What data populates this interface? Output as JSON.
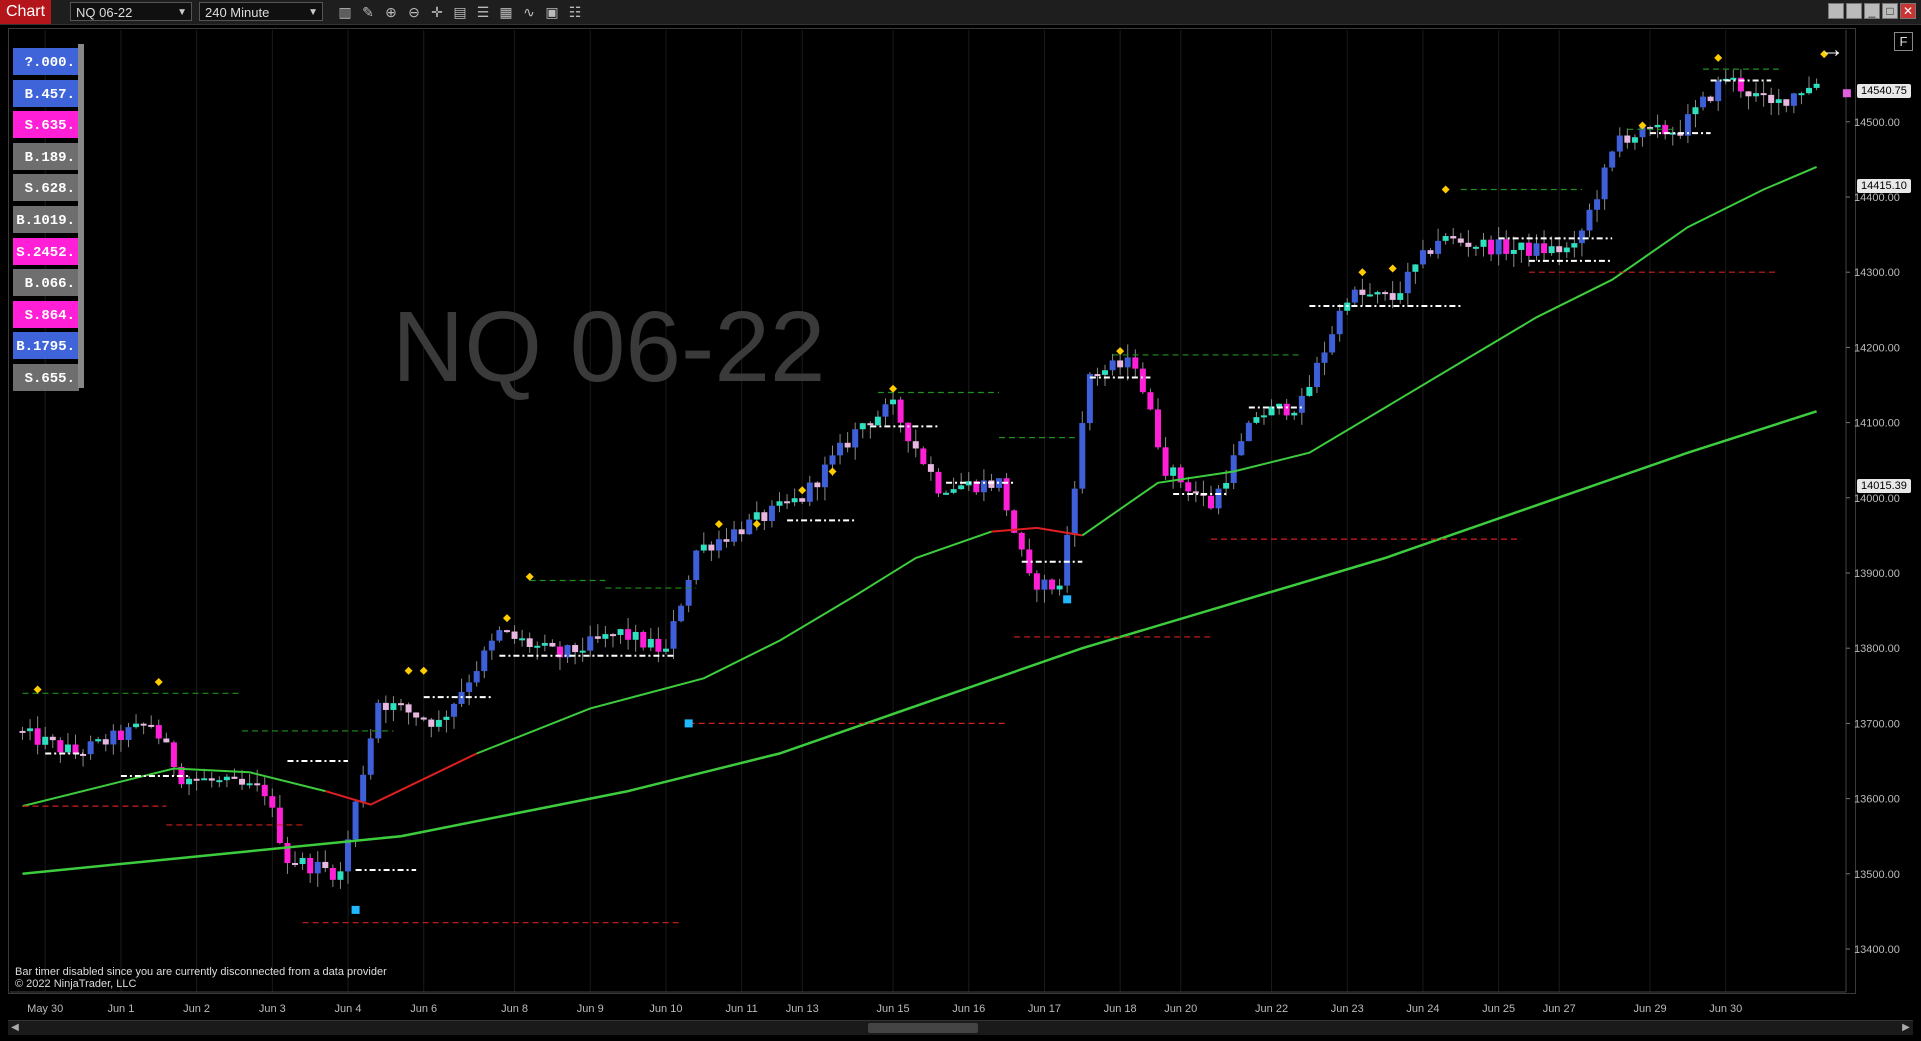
{
  "app": {
    "tab_label": "Chart"
  },
  "toolbar": {
    "instrument": "NQ 06-22",
    "interval": "240 Minute",
    "tools": [
      "bar-type-icon",
      "draw-icon",
      "zoom-in-icon",
      "zoom-out-icon",
      "crosshair-icon",
      "data-box-icon",
      "properties-icon",
      "strategy-icon",
      "indicators-icon",
      "templates-icon",
      "list-icon"
    ]
  },
  "watermark": "NQ 06-22",
  "status": {
    "line1": "Bar timer disabled since you are currently disconnected from a data provider",
    "line2": "© 2022 NinjaTrader, LLC"
  },
  "f_button": "F",
  "positions": [
    {
      "label": "?.000.",
      "color": "#3f63d9"
    },
    {
      "label": "B.457.",
      "color": "#3f63d9"
    },
    {
      "label": "S.635.",
      "color": "#ff1fd6"
    },
    {
      "label": "B.189.",
      "color": "#6e6e6e"
    },
    {
      "label": "S.628.",
      "color": "#6e6e6e"
    },
    {
      "label": "B.1019.",
      "color": "#6e6e6e"
    },
    {
      "label": "S.2452.",
      "color": "#ff1fd6"
    },
    {
      "label": "B.066.",
      "color": "#6e6e6e"
    },
    {
      "label": "S.864.",
      "color": "#ff1fd6"
    },
    {
      "label": "B.1795.",
      "color": "#3f63d9"
    },
    {
      "label": "S.655.",
      "color": "#6e6e6e"
    }
  ],
  "price_tags": [
    {
      "text": "14540.75",
      "price": 14540.75
    },
    {
      "text": "14415.10",
      "price": 14415.1
    },
    {
      "text": "14015.39",
      "price": 14015.39
    }
  ],
  "colors": {
    "bull_strong": "#3f5fd8",
    "bull_weak": "#2ee0c0",
    "bear_strong": "#ff1fd6",
    "bear_weak": "#e8b8e0",
    "ma_fast": "#3dcc3d",
    "ma_fast_down": "#e02020",
    "ma_slow": "#3dcc3d",
    "resistance": "#1f8f1f",
    "support": "#d02020",
    "pivot": "#ffffff",
    "diamond": "#ffcc00"
  },
  "chart_data": {
    "type": "candlestick",
    "instrument": "NQ 06-22",
    "interval": "240 Minute",
    "ylim": [
      13340,
      14640
    ],
    "y_ticks": [
      13400,
      13500,
      13600,
      13700,
      13800,
      13900,
      14000,
      14100,
      14200,
      14300,
      14400,
      14500
    ],
    "y_tick_labels": [
      "13400.00",
      "13500.00",
      "13600.00",
      "13700.00",
      "13800.00",
      "13900.00",
      "14000.00",
      "14100.00",
      "14200.00",
      "14300.00",
      "14400.00",
      "14500.00"
    ],
    "x_ticks": [
      {
        "label": "May 30",
        "bar": 3
      },
      {
        "label": "Jun 1",
        "bar": 13
      },
      {
        "label": "Jun 2",
        "bar": 23
      },
      {
        "label": "Jun 3",
        "bar": 33
      },
      {
        "label": "Jun 4",
        "bar": 43
      },
      {
        "label": "Jun 6",
        "bar": 53
      },
      {
        "label": "Jun 8",
        "bar": 65
      },
      {
        "label": "Jun 9",
        "bar": 75
      },
      {
        "label": "Jun 10",
        "bar": 85
      },
      {
        "label": "Jun 11",
        "bar": 95
      },
      {
        "label": "Jun 13",
        "bar": 103
      },
      {
        "label": "Jun 15",
        "bar": 115
      },
      {
        "label": "Jun 16",
        "bar": 125
      },
      {
        "label": "Jun 17",
        "bar": 135
      },
      {
        "label": "Jun 18",
        "bar": 145
      },
      {
        "label": "Jun 20",
        "bar": 153
      },
      {
        "label": "Jun 22",
        "bar": 165
      },
      {
        "label": "Jun 23",
        "bar": 175
      },
      {
        "label": "Jun 24",
        "bar": 185
      },
      {
        "label": "Jun 25",
        "bar": 195
      },
      {
        "label": "Jun 27",
        "bar": 203
      },
      {
        "label": "Jun 29",
        "bar": 215
      },
      {
        "label": "Jun 30",
        "bar": 225
      }
    ],
    "price_lines": [
      {
        "style": "resistance",
        "price": 13740,
        "from": 0,
        "to": 29
      },
      {
        "style": "resistance",
        "price": 13690,
        "from": 29,
        "to": 49
      },
      {
        "style": "resistance",
        "price": 13890,
        "from": 67,
        "to": 77
      },
      {
        "style": "resistance",
        "price": 13880,
        "from": 77,
        "to": 89
      },
      {
        "style": "resistance",
        "price": 14140,
        "from": 113,
        "to": 129
      },
      {
        "style": "resistance",
        "price": 14080,
        "from": 129,
        "to": 139
      },
      {
        "style": "resistance",
        "price": 14190,
        "from": 144,
        "to": 169
      },
      {
        "style": "resistance",
        "price": 14410,
        "from": 190,
        "to": 206
      },
      {
        "style": "resistance",
        "price": 14490,
        "from": 212,
        "to": 218
      },
      {
        "style": "resistance",
        "price": 14570,
        "from": 222,
        "to": 232
      },
      {
        "style": "support",
        "price": 13590,
        "from": 0,
        "to": 19
      },
      {
        "style": "support",
        "price": 13565,
        "from": 19,
        "to": 37
      },
      {
        "style": "support",
        "price": 13435,
        "from": 37,
        "to": 87
      },
      {
        "style": "support",
        "price": 13700,
        "from": 88,
        "to": 130
      },
      {
        "style": "support",
        "price": 13815,
        "from": 131,
        "to": 157
      },
      {
        "style": "support",
        "price": 13945,
        "from": 157,
        "to": 198
      },
      {
        "style": "support",
        "price": 14300,
        "from": 199,
        "to": 232
      },
      {
        "style": "pivot",
        "price": 13660,
        "from": 3,
        "to": 8
      },
      {
        "style": "pivot",
        "price": 13630,
        "from": 13,
        "to": 22
      },
      {
        "style": "pivot",
        "price": 13650,
        "from": 35,
        "to": 43
      },
      {
        "style": "pivot",
        "price": 13505,
        "from": 44,
        "to": 52
      },
      {
        "style": "pivot",
        "price": 13735,
        "from": 53,
        "to": 62
      },
      {
        "style": "pivot",
        "price": 13790,
        "from": 63,
        "to": 86
      },
      {
        "style": "pivot",
        "price": 13970,
        "from": 101,
        "to": 110
      },
      {
        "style": "pivot",
        "price": 14095,
        "from": 112,
        "to": 121
      },
      {
        "style": "pivot",
        "price": 14020,
        "from": 122,
        "to": 131
      },
      {
        "style": "pivot",
        "price": 13915,
        "from": 132,
        "to": 140
      },
      {
        "style": "pivot",
        "price": 14160,
        "from": 141,
        "to": 149
      },
      {
        "style": "pivot",
        "price": 14005,
        "from": 152,
        "to": 159
      },
      {
        "style": "pivot",
        "price": 14120,
        "from": 162,
        "to": 169
      },
      {
        "style": "pivot",
        "price": 14255,
        "from": 170,
        "to": 190
      },
      {
        "style": "pivot",
        "price": 14345,
        "from": 195,
        "to": 210
      },
      {
        "style": "pivot",
        "price": 14315,
        "from": 199,
        "to": 210
      },
      {
        "style": "pivot",
        "price": 14485,
        "from": 215,
        "to": 223
      },
      {
        "style": "pivot",
        "price": 14555,
        "from": 223,
        "to": 231
      }
    ],
    "diamonds": [
      {
        "bar": 2,
        "price": 13745
      },
      {
        "bar": 18,
        "price": 13755
      },
      {
        "bar": 51,
        "price": 13770
      },
      {
        "bar": 53,
        "price": 13770
      },
      {
        "bar": 64,
        "price": 13840
      },
      {
        "bar": 67,
        "price": 13895
      },
      {
        "bar": 92,
        "price": 13965
      },
      {
        "bar": 97,
        "price": 13965
      },
      {
        "bar": 103,
        "price": 14010
      },
      {
        "bar": 107,
        "price": 14035
      },
      {
        "bar": 115,
        "price": 14145
      },
      {
        "bar": 145,
        "price": 14195
      },
      {
        "bar": 177,
        "price": 14300
      },
      {
        "bar": 181,
        "price": 14305
      },
      {
        "bar": 188,
        "price": 14410
      },
      {
        "bar": 214,
        "price": 14495
      },
      {
        "bar": 224,
        "price": 14585
      },
      {
        "bar": 238,
        "price": 14590
      }
    ],
    "markers": [
      {
        "bar": 44,
        "price": 13452,
        "color": "#20b8ff"
      },
      {
        "bar": 88,
        "price": 13700,
        "color": "#20b8ff"
      },
      {
        "bar": 138,
        "price": 13865,
        "color": "#20b8ff"
      },
      {
        "bar": 241,
        "price": 14538,
        "color": "#e060e0"
      }
    ]
  }
}
